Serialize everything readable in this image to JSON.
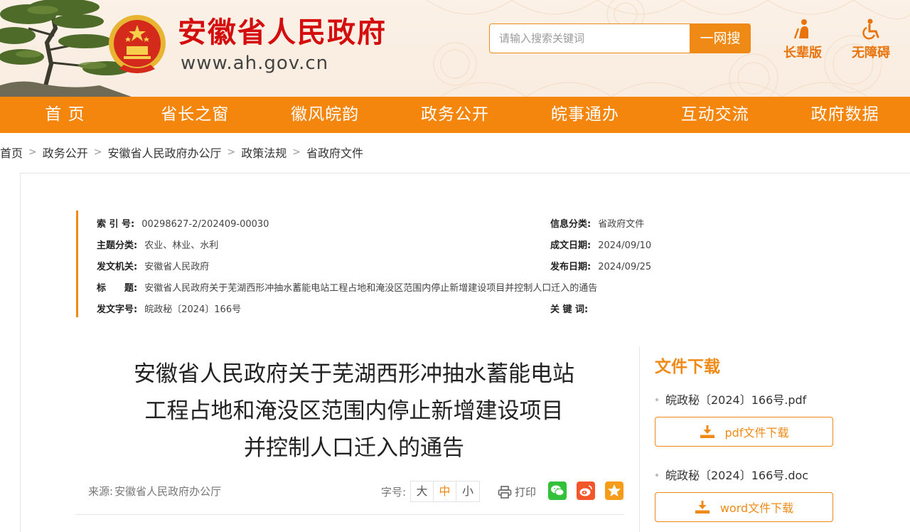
{
  "header": {
    "site_title": "安徽省人民政府",
    "site_url": "www.ah.gov.cn",
    "search_placeholder": "请输入搜索关键词",
    "search_button": "一网搜",
    "elder_label": "长辈版",
    "accessibility_label": "无障碍"
  },
  "nav": {
    "items": [
      "首 页",
      "省长之窗",
      "徽风皖韵",
      "政务公开",
      "皖事通办",
      "互动交流",
      "政府数据"
    ]
  },
  "breadcrumb": [
    "首页",
    "政务公开",
    "安徽省人民政府办公厅",
    "政策法规",
    "省政府文件"
  ],
  "meta": {
    "index_label": "索 引 号:",
    "index_value": "00298627-2/202409-00030",
    "info_cat_label": "信息分类:",
    "info_cat_value": "省政府文件",
    "topic_label": "主题分类:",
    "topic_value": "农业、林业、水利",
    "created_label": "成文日期:",
    "created_value": "2024/09/10",
    "issuer_label": "发文机关:",
    "issuer_value": "安徽省人民政府",
    "published_label": "发布日期:",
    "published_value": "2024/09/25",
    "title_label": "标　　题:",
    "title_value": "安徽省人民政府关于芜湖西形冲抽水蓄能电站工程占地和淹没区范围内停止新增建设项目并控制人口迁入的通告",
    "docno_label": "发文字号:",
    "docno_value": "皖政秘〔2024〕166号",
    "keywords_label": "关 键 词:",
    "keywords_value": ""
  },
  "document": {
    "title_line1": "安徽省人民政府关于芜湖西形冲抽水蓄能电站",
    "title_line2": "工程占地和淹没区范围内停止新增建设项目",
    "title_line3": "并控制人口迁入的通告",
    "source_label": "来源:",
    "source_value": "安徽省人民政府办公厅",
    "fontsize_label": "字号:",
    "fontsize_large": "大",
    "fontsize_medium": "中",
    "fontsize_small": "小",
    "print_label": "打印"
  },
  "downloads": {
    "title": "文件下载",
    "files": [
      {
        "name": "皖政秘〔2024〕166号.pdf",
        "button": "pdf文件下载"
      },
      {
        "name": "皖政秘〔2024〕166号.doc",
        "button": "word文件下载"
      }
    ]
  },
  "colors": {
    "brand_orange": "#f4860e",
    "title_red": "#d40e0e"
  }
}
